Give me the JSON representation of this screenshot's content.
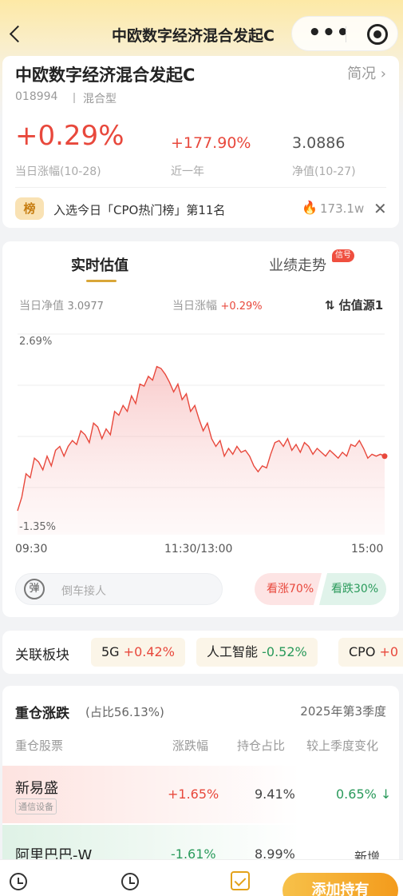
{
  "nav": {
    "title": "中欧数字经济混合发起C",
    "more": "•••"
  },
  "fund": {
    "name": "中欧数字经济混合发起C",
    "overview": "简况 ›",
    "code": "018994",
    "type": "混合型",
    "daily_change": "+0.29%",
    "daily_change_label": "当日涨幅(10-28)",
    "year_change": "+177.90%",
    "year_change_label": "近一年",
    "nav_value": "3.0886",
    "nav_label": "净值(10-27)",
    "rank_badge": "榜",
    "rank_text": "入选今日「CPO热门榜」第11名",
    "heat": "173.1w",
    "fire_icon": "🔥",
    "close": "✕"
  },
  "estimate": {
    "tab_realtime": "实时估值",
    "tab_performance": "业绩走势",
    "signal_tag": "信号",
    "nav_label": "当日净值",
    "nav_value": "3.0977",
    "change_label": "当日涨幅",
    "change_value": "+0.29%",
    "source": "⇅ 估值源1",
    "time_open": "09:30",
    "time_mid": "11:30/13:00",
    "time_close": "15:00",
    "comment_icon": "弹",
    "comment_placeholder": "倒车接人",
    "vote_up": "看涨70%",
    "vote_down": "看跌30%"
  },
  "chart_data": {
    "type": "area",
    "ylim": [
      -1.35,
      2.69
    ],
    "ytick_labels": [
      "2.69%",
      "-1.35%"
    ],
    "x_labels": [
      "09:30",
      "11:30/13:00",
      "15:00"
    ],
    "line_color": "#e8483c",
    "y": [
      -1.35,
      -1.0,
      -0.4,
      -0.5,
      0.0,
      -0.1,
      -0.3,
      0.05,
      -0.2,
      0.2,
      0.3,
      0.05,
      0.3,
      0.45,
      0.35,
      0.7,
      0.6,
      0.4,
      0.9,
      0.8,
      0.5,
      0.75,
      0.6,
      1.2,
      1.1,
      1.35,
      1.2,
      1.6,
      1.4,
      1.9,
      1.85,
      2.1,
      2.0,
      2.35,
      2.3,
      2.15,
      1.95,
      1.7,
      1.9,
      1.5,
      1.65,
      1.2,
      1.35,
      1.0,
      0.7,
      0.9,
      0.5,
      0.3,
      0.45,
      0.05,
      0.25,
      0.1,
      0.3,
      0.15,
      0.2,
      0.05,
      -0.2,
      -0.35,
      -0.2,
      -0.25,
      0.1,
      0.4,
      0.45,
      0.3,
      0.5,
      0.2,
      0.35,
      0.15,
      0.4,
      0.3,
      0.1,
      0.25,
      0.15,
      0.05,
      0.2,
      0.1,
      0.0,
      0.15,
      0.05,
      0.35,
      0.3,
      0.45,
      0.25,
      0.0,
      0.1,
      0.05,
      0.1,
      0.05
    ]
  },
  "sectors": {
    "title": "关联板块",
    "items": [
      {
        "name": "5G",
        "change": "+0.42%",
        "dir": "up"
      },
      {
        "name": "人工智能",
        "change": "-0.52%",
        "dir": "down"
      },
      {
        "name": "CPO",
        "change": "+0",
        "dir": "up"
      }
    ]
  },
  "holdings": {
    "title": "重仓涨跌",
    "ratio": "(占比56.13%)",
    "quarter": "2025年第3季度",
    "col_stock": "重仓股票",
    "col_change": "涨跌幅",
    "col_weight": "持仓占比",
    "col_delta": "较上季度变化",
    "rows": [
      {
        "name": "新易盛",
        "tag": "通信设备",
        "change": "+1.65%",
        "weight": "9.41%",
        "delta": "0.65% ↓"
      },
      {
        "name": "阿里巴巴-W",
        "tag": "",
        "change": "-1.61%",
        "weight": "8.99%",
        "delta": "新增"
      }
    ]
  },
  "bottom": {
    "add_button": "添加持有"
  }
}
